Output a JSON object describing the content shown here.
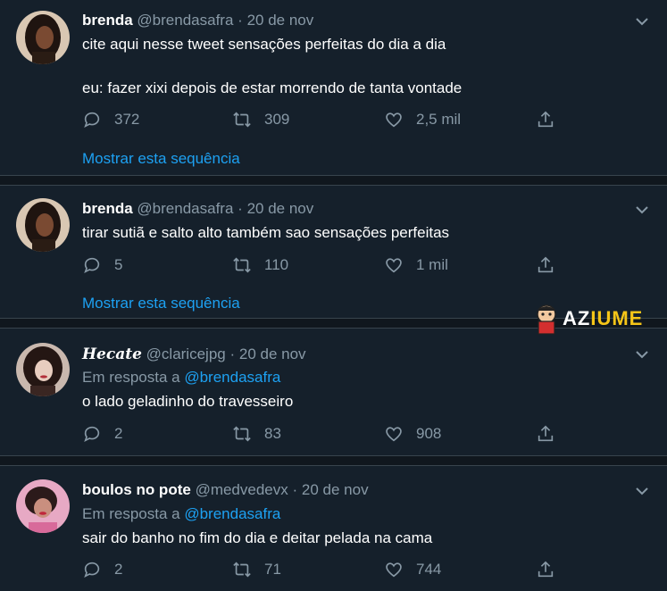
{
  "tweets": [
    {
      "name": "brenda",
      "handle": "@brendasafra",
      "separator": "·",
      "date": "20 de nov",
      "reply_label": "",
      "reply_mention": "",
      "text_lines": [
        "cite aqui nesse tweet sensações perfeitas do dia a dia",
        "eu: fazer xixi depois de estar morrendo de tanta vontade"
      ],
      "replies": "372",
      "retweets": "309",
      "likes": "2,5 mil",
      "thread_link": "Mostrar esta sequência"
    },
    {
      "name": "brenda",
      "handle": "@brendasafra",
      "separator": "·",
      "date": "20 de nov",
      "text_lines": [
        "tirar sutiã e salto alto também sao sensações perfeitas"
      ],
      "replies": "5",
      "retweets": "110",
      "likes": "1 mil",
      "thread_link": "Mostrar esta sequência"
    },
    {
      "name": "Hecate",
      "handle": "@claricejpg",
      "separator": "·",
      "date": "20 de nov",
      "reply_label": "Em resposta a",
      "reply_mention": "@brendasafra",
      "text_lines": [
        "o lado geladinho do travesseiro"
      ],
      "replies": "2",
      "retweets": "83",
      "likes": "908"
    },
    {
      "name": "boulos no pote",
      "handle": "@medvedevx",
      "separator": "·",
      "date": "20 de nov",
      "reply_label": "Em resposta a",
      "reply_mention": "@brendasafra",
      "text_lines": [
        "sair do banho no fim do dia e deitar pelada na cama"
      ],
      "replies": "2",
      "retweets": "71",
      "likes": "744"
    }
  ],
  "watermark": {
    "part1": "AZ",
    "part2": "IUME"
  },
  "colors": {
    "background": "#15202b",
    "divider": "#10171e",
    "muted": "#8899a6",
    "accent": "#1da1f2",
    "watermark_yellow": "#f5c518"
  },
  "icons": [
    "reply-icon",
    "retweet-icon",
    "like-icon",
    "share-icon",
    "chevron-down-icon"
  ]
}
